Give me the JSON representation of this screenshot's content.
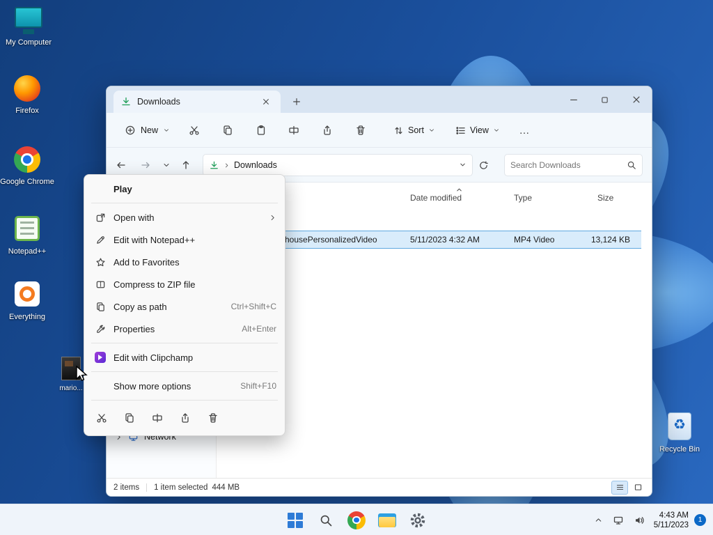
{
  "icons": {
    "ellipsis": "…",
    "recycle": "♻"
  },
  "desktop": {
    "icons": [
      {
        "label": "My Computer"
      },
      {
        "label": "Firefox"
      },
      {
        "label": "Google Chrome"
      },
      {
        "label": "Notepad++"
      },
      {
        "label": "Everything"
      },
      {
        "label": "mario..."
      },
      {
        "label": "Recycle Bin"
      }
    ]
  },
  "window": {
    "tab_title": "Downloads",
    "toolbar": {
      "new": "New",
      "sort": "Sort",
      "view": "View"
    },
    "address": {
      "breadcrumb": "Downloads",
      "search_placeholder": "Search Downloads"
    },
    "columns": {
      "date_modified": "Date modified",
      "type": "Type",
      "size": "Size"
    },
    "file": {
      "name": "housePersonalizedVideo",
      "date_modified": "5/11/2023 4:32 AM",
      "type": "MP4 Video",
      "size": "13,124 KB"
    },
    "sidebar": {
      "network": "Network"
    },
    "status": {
      "items": "2 items",
      "selected": "1 item selected",
      "size": "444 MB"
    }
  },
  "context_menu": {
    "items": [
      {
        "label": "Play",
        "shortcut": ""
      },
      {
        "label": "Open with",
        "shortcut": ""
      },
      {
        "label": "Edit with Notepad++",
        "shortcut": ""
      },
      {
        "label": "Add to Favorites",
        "shortcut": ""
      },
      {
        "label": "Compress to ZIP file",
        "shortcut": ""
      },
      {
        "label": "Copy as path",
        "shortcut": "Ctrl+Shift+C"
      },
      {
        "label": "Properties",
        "shortcut": "Alt+Enter"
      },
      {
        "label": "Edit with Clipchamp",
        "shortcut": ""
      },
      {
        "label": "Show more options",
        "shortcut": "Shift+F10"
      }
    ]
  },
  "taskbar": {
    "time": "4:43 AM",
    "date": "5/11/2023",
    "badge": "1"
  }
}
